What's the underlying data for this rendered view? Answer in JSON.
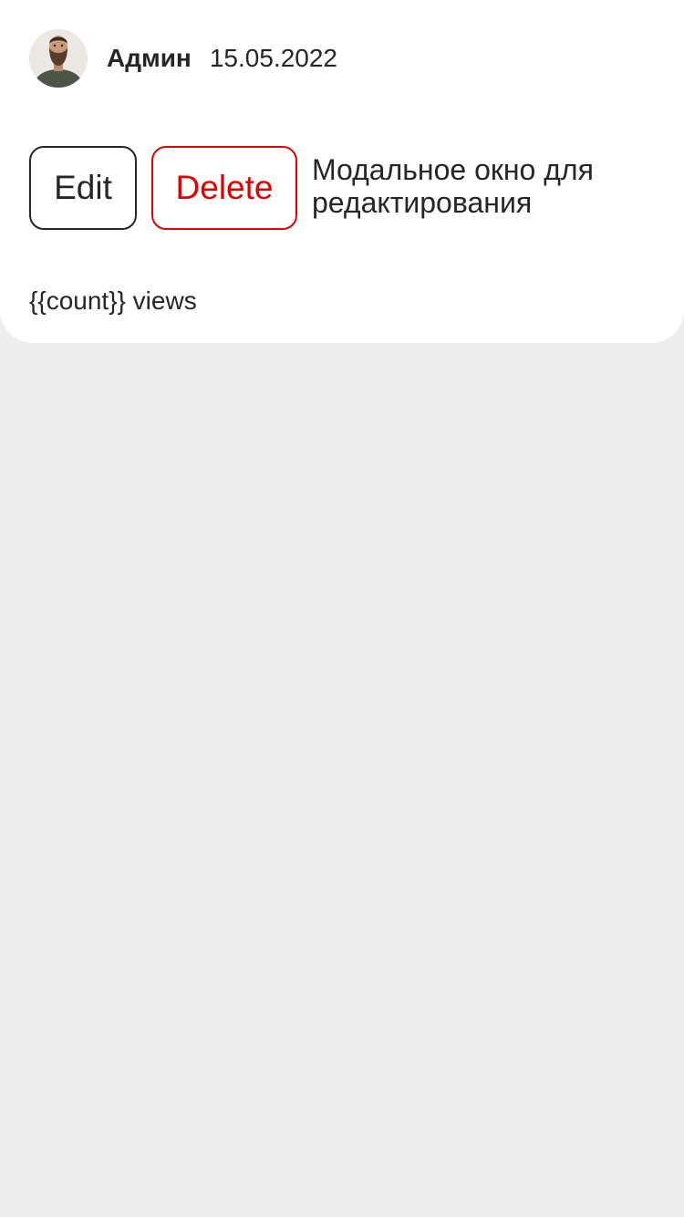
{
  "post": {
    "author": "Админ",
    "date": "15.05.2022",
    "actions": {
      "edit_label": "Edit",
      "delete_label": "Delete",
      "modal_label": "Модальное окно для редактирования"
    },
    "views_label": "{{count}} views"
  },
  "colors": {
    "background": "#ededed",
    "card": "#ffffff",
    "text": "#262626",
    "danger": "#e00000"
  },
  "icons": {
    "avatar": "bearded-man-avatar"
  }
}
